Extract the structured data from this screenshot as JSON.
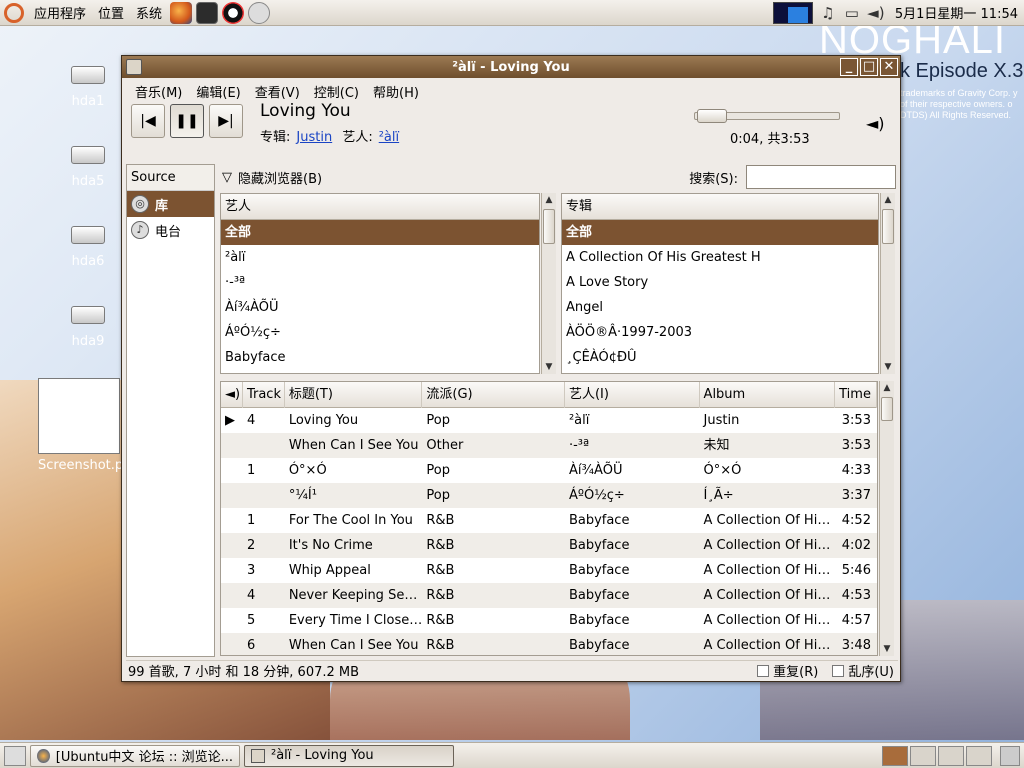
{
  "top_panel": {
    "menus": [
      "应用程序",
      "位置",
      "系统"
    ],
    "clock": "5月1日星期一 11:54"
  },
  "wallpaper": {
    "brand": "NOGHALI",
    "subtitle": "k Episode X.3",
    "small_text": "trademarks of Gravity Corp. y of their respective owners. o DTDS) All Rights Reserved."
  },
  "desktop_icons": [
    "hda1",
    "hda5",
    "hda6",
    "hda9"
  ],
  "desktop_screenshot_label": "Screenshot.p",
  "window": {
    "title": "²àlï - Loving You",
    "menus": [
      "音乐(M)",
      "编辑(E)",
      "查看(V)",
      "控制(C)",
      "帮助(H)"
    ],
    "now_playing": {
      "title": "Loving You",
      "album_label": "专辑:",
      "album": "Justin",
      "artist_label": "艺人:",
      "artist": "²àlï"
    },
    "time": "0:04, 共3:53",
    "progress": 0.02,
    "source": {
      "header": "Source",
      "items": [
        {
          "label": "库",
          "icon": "library-icon",
          "selected": true
        },
        {
          "label": "电台",
          "icon": "radio-icon",
          "selected": false
        }
      ]
    },
    "browser": {
      "toggle": "隐藏浏览器(B)",
      "search_label": "搜索(S):",
      "search_value": ""
    },
    "artists": {
      "header": "艺人",
      "items": [
        "全部",
        "²àlï",
        "·-³ª",
        "Àí¾ÀÕÜ",
        "ÁºÓ½ç÷",
        "Babyface"
      ]
    },
    "albums": {
      "header": "专辑",
      "items": [
        "全部",
        "A Collection Of His Greatest H",
        "A Love Story",
        "Angel",
        "ÀÖÖ®Â·1997-2003",
        "¸ÇÊÀÓ¢ÐÛ"
      ]
    },
    "tracks": {
      "columns": [
        "",
        "Track",
        "标题(T)",
        "流派(G)",
        "艺人(I)",
        "Album",
        "Time"
      ],
      "rows": [
        {
          "playing": "▶",
          "track": "4",
          "title": "Loving You",
          "genre": "Pop",
          "artist": "²àlï",
          "album": "Justin",
          "time": "3:53"
        },
        {
          "playing": "",
          "track": "",
          "title": "When Can I See You",
          "genre": "Other",
          "artist": "·-³ª",
          "album": "未知",
          "time": "3:53"
        },
        {
          "playing": "",
          "track": "1",
          "title": "Ó°×Ó",
          "genre": "Pop",
          "artist": "Àí¾ÀÕÜ",
          "album": "Ó°×Ó",
          "time": "4:33"
        },
        {
          "playing": "",
          "track": "",
          "title": "°¼Í¹",
          "genre": "Pop",
          "artist": "ÁºÓ½ç÷",
          "album": "Í¸Ã÷",
          "time": "3:37"
        },
        {
          "playing": "",
          "track": "1",
          "title": "For The Cool In You",
          "genre": "R&B",
          "artist": "Babyface",
          "album": "A Collection Of His Greatest Hits",
          "time": "4:52"
        },
        {
          "playing": "",
          "track": "2",
          "title": "It's No Crime",
          "genre": "R&B",
          "artist": "Babyface",
          "album": "A Collection Of His Greatest Hits",
          "time": "4:02"
        },
        {
          "playing": "",
          "track": "3",
          "title": "Whip Appeal",
          "genre": "R&B",
          "artist": "Babyface",
          "album": "A Collection Of His Greatest Hits",
          "time": "5:46"
        },
        {
          "playing": "",
          "track": "4",
          "title": "Never Keeping Secrets",
          "genre": "R&B",
          "artist": "Babyface",
          "album": "A Collection Of His Greatest Hits",
          "time": "4:53"
        },
        {
          "playing": "",
          "track": "5",
          "title": "Every Time I Close My Eyes",
          "genre": "R&B",
          "artist": "Babyface",
          "album": "A Collection Of His Greatest Hits",
          "time": "4:57"
        },
        {
          "playing": "",
          "track": "6",
          "title": "When Can I See You",
          "genre": "R&B",
          "artist": "Babyface",
          "album": "A Collection Of His Greatest Hits",
          "time": "3:48"
        }
      ]
    },
    "status": "99 首歌, 7 小时 和 18 分钟, 607.2 MB",
    "repeat_label": "重复(R)",
    "shuffle_label": "乱序(U)"
  },
  "taskbar": {
    "tasks": [
      "[Ubuntu中文 论坛 :: 浏览论...",
      "²àlï - Loving You"
    ]
  }
}
